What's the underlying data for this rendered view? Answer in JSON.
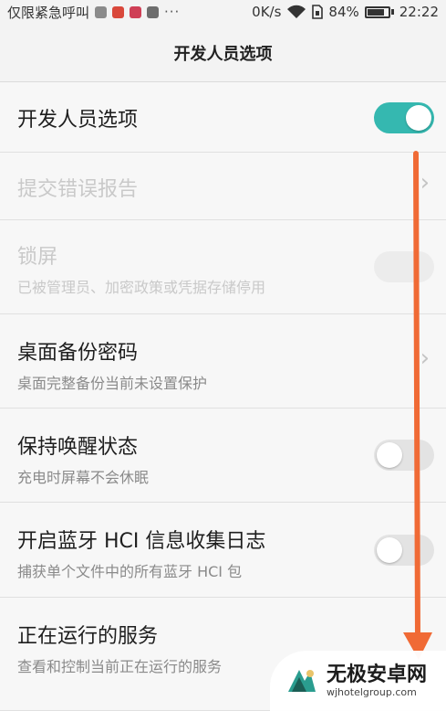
{
  "status_bar": {
    "carrier": "仅限紧急呼叫",
    "more": "···",
    "speed": "0K/s",
    "battery": "84%",
    "time": "22:22"
  },
  "header": {
    "title": "开发人员选项"
  },
  "rows": [
    {
      "title": "开发人员选项",
      "subtitle": "",
      "control": "toggle",
      "state": "on",
      "enabled": true
    },
    {
      "title": "提交错误报告",
      "subtitle": "",
      "control": "chevron",
      "enabled": false
    },
    {
      "title": "锁屏",
      "subtitle": "已被管理员、加密政策或凭据存储停用",
      "control": "toggle",
      "state": "off",
      "enabled": false
    },
    {
      "title": "桌面备份密码",
      "subtitle": "桌面完整备份当前未设置保护",
      "control": "chevron",
      "enabled": true
    },
    {
      "title": "保持唤醒状态",
      "subtitle": "充电时屏幕不会休眠",
      "control": "toggle",
      "state": "off",
      "enabled": true
    },
    {
      "title": "开启蓝牙 HCI 信息收集日志",
      "subtitle": "捕获单个文件中的所有蓝牙 HCI 包",
      "control": "toggle",
      "state": "off",
      "enabled": true
    },
    {
      "title": "正在运行的服务",
      "subtitle": "查看和控制当前正在运行的服务",
      "control": "none",
      "enabled": true
    }
  ],
  "chevron_glyph": "›",
  "watermark": {
    "name": "无极安卓网",
    "url": "wjhotelgroup.com"
  },
  "colors": {
    "accent": "#35b8b0",
    "arrow": "#f06a35"
  }
}
